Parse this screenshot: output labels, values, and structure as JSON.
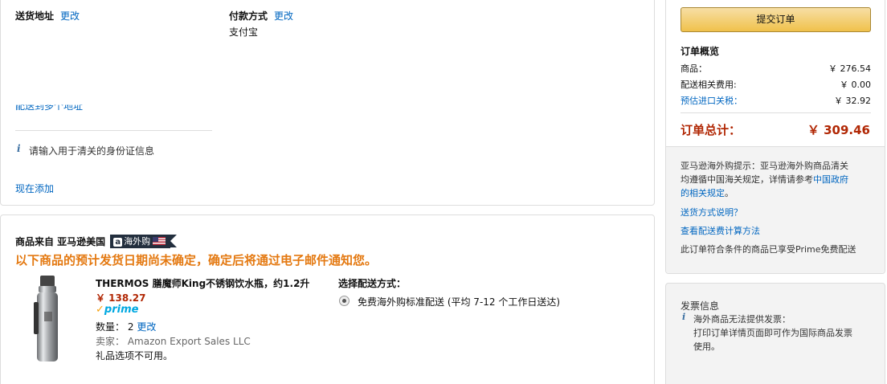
{
  "address": {
    "label": "送货地址",
    "change_link": "更改",
    "multi_address_link": "配送到多个地址",
    "id_info": "请输入用于清关的身份证信息",
    "add_now_link": "现在添加"
  },
  "payment": {
    "label": "付款方式",
    "change_link": "更改",
    "method": "支付宝"
  },
  "shipment": {
    "from_label": "商品来自 亚马逊美国",
    "badge_text": "海外购",
    "badge_logo": "a",
    "notice": "以下商品的预计发货日期尚未确定，确定后将通过电子邮件通知您。",
    "item": {
      "title": "THERMOS 膳魔师King不锈钢饮水瓶，约1.2升",
      "price": "￥ 138.27",
      "prime": "prime",
      "quantity_label": "数量：",
      "quantity": "2",
      "quantity_change": "更改",
      "seller_label": "卖家：",
      "seller": "Amazon Export Sales LLC",
      "gift": "礼品选项不可用。"
    },
    "delivery": {
      "label": "选择配送方式：",
      "option": "免费海外购标准配送 (平均 7-12 个工作日送达)"
    }
  },
  "order": {
    "submit_label": "提交订单",
    "summary_title": "订单概览",
    "rows": [
      {
        "label": "商品：",
        "value": "￥ 276.54"
      },
      {
        "label": "配送相关费用:",
        "value": "￥ 0.00"
      },
      {
        "label": "预估进口关税：",
        "value": "￥ 32.92"
      }
    ],
    "total_label": "订单总计：",
    "total_value": "￥ 309.46",
    "notice_prefix": "亚马逊海外购提示：亚马逊海外购商品清关",
    "notice_line2": "均遵循中国海关规定，详情请参考",
    "notice_link": "中国政府的相关规定",
    "notice_link_part1": "中国政府",
    "notice_link_part2": "的相关规定",
    "notice_suffix": "。",
    "shipping_desc_link": "送货方式说明？",
    "fee_calc_link": "查看配送费计算方法",
    "prime_notice": "此订单符合条件的商品已享受Prime免费配送",
    "invoice_title": "发票信息",
    "invoice_line1": "海外商品无法提供发票：",
    "invoice_line2": "打印订单详情页面即可作为国际商品发票",
    "invoice_line3": "使用。"
  },
  "colors": {
    "link": "#0066c0",
    "price": "#b12704",
    "notice_orange": "#e47911",
    "button": "#f0c14b",
    "badge": "#232f3e"
  },
  "icons": [
    "info-icon",
    "amazon-a-icon",
    "us-flag-icon",
    "radio-selected-icon",
    "thermos-bottle-image",
    "prime-logo"
  ]
}
